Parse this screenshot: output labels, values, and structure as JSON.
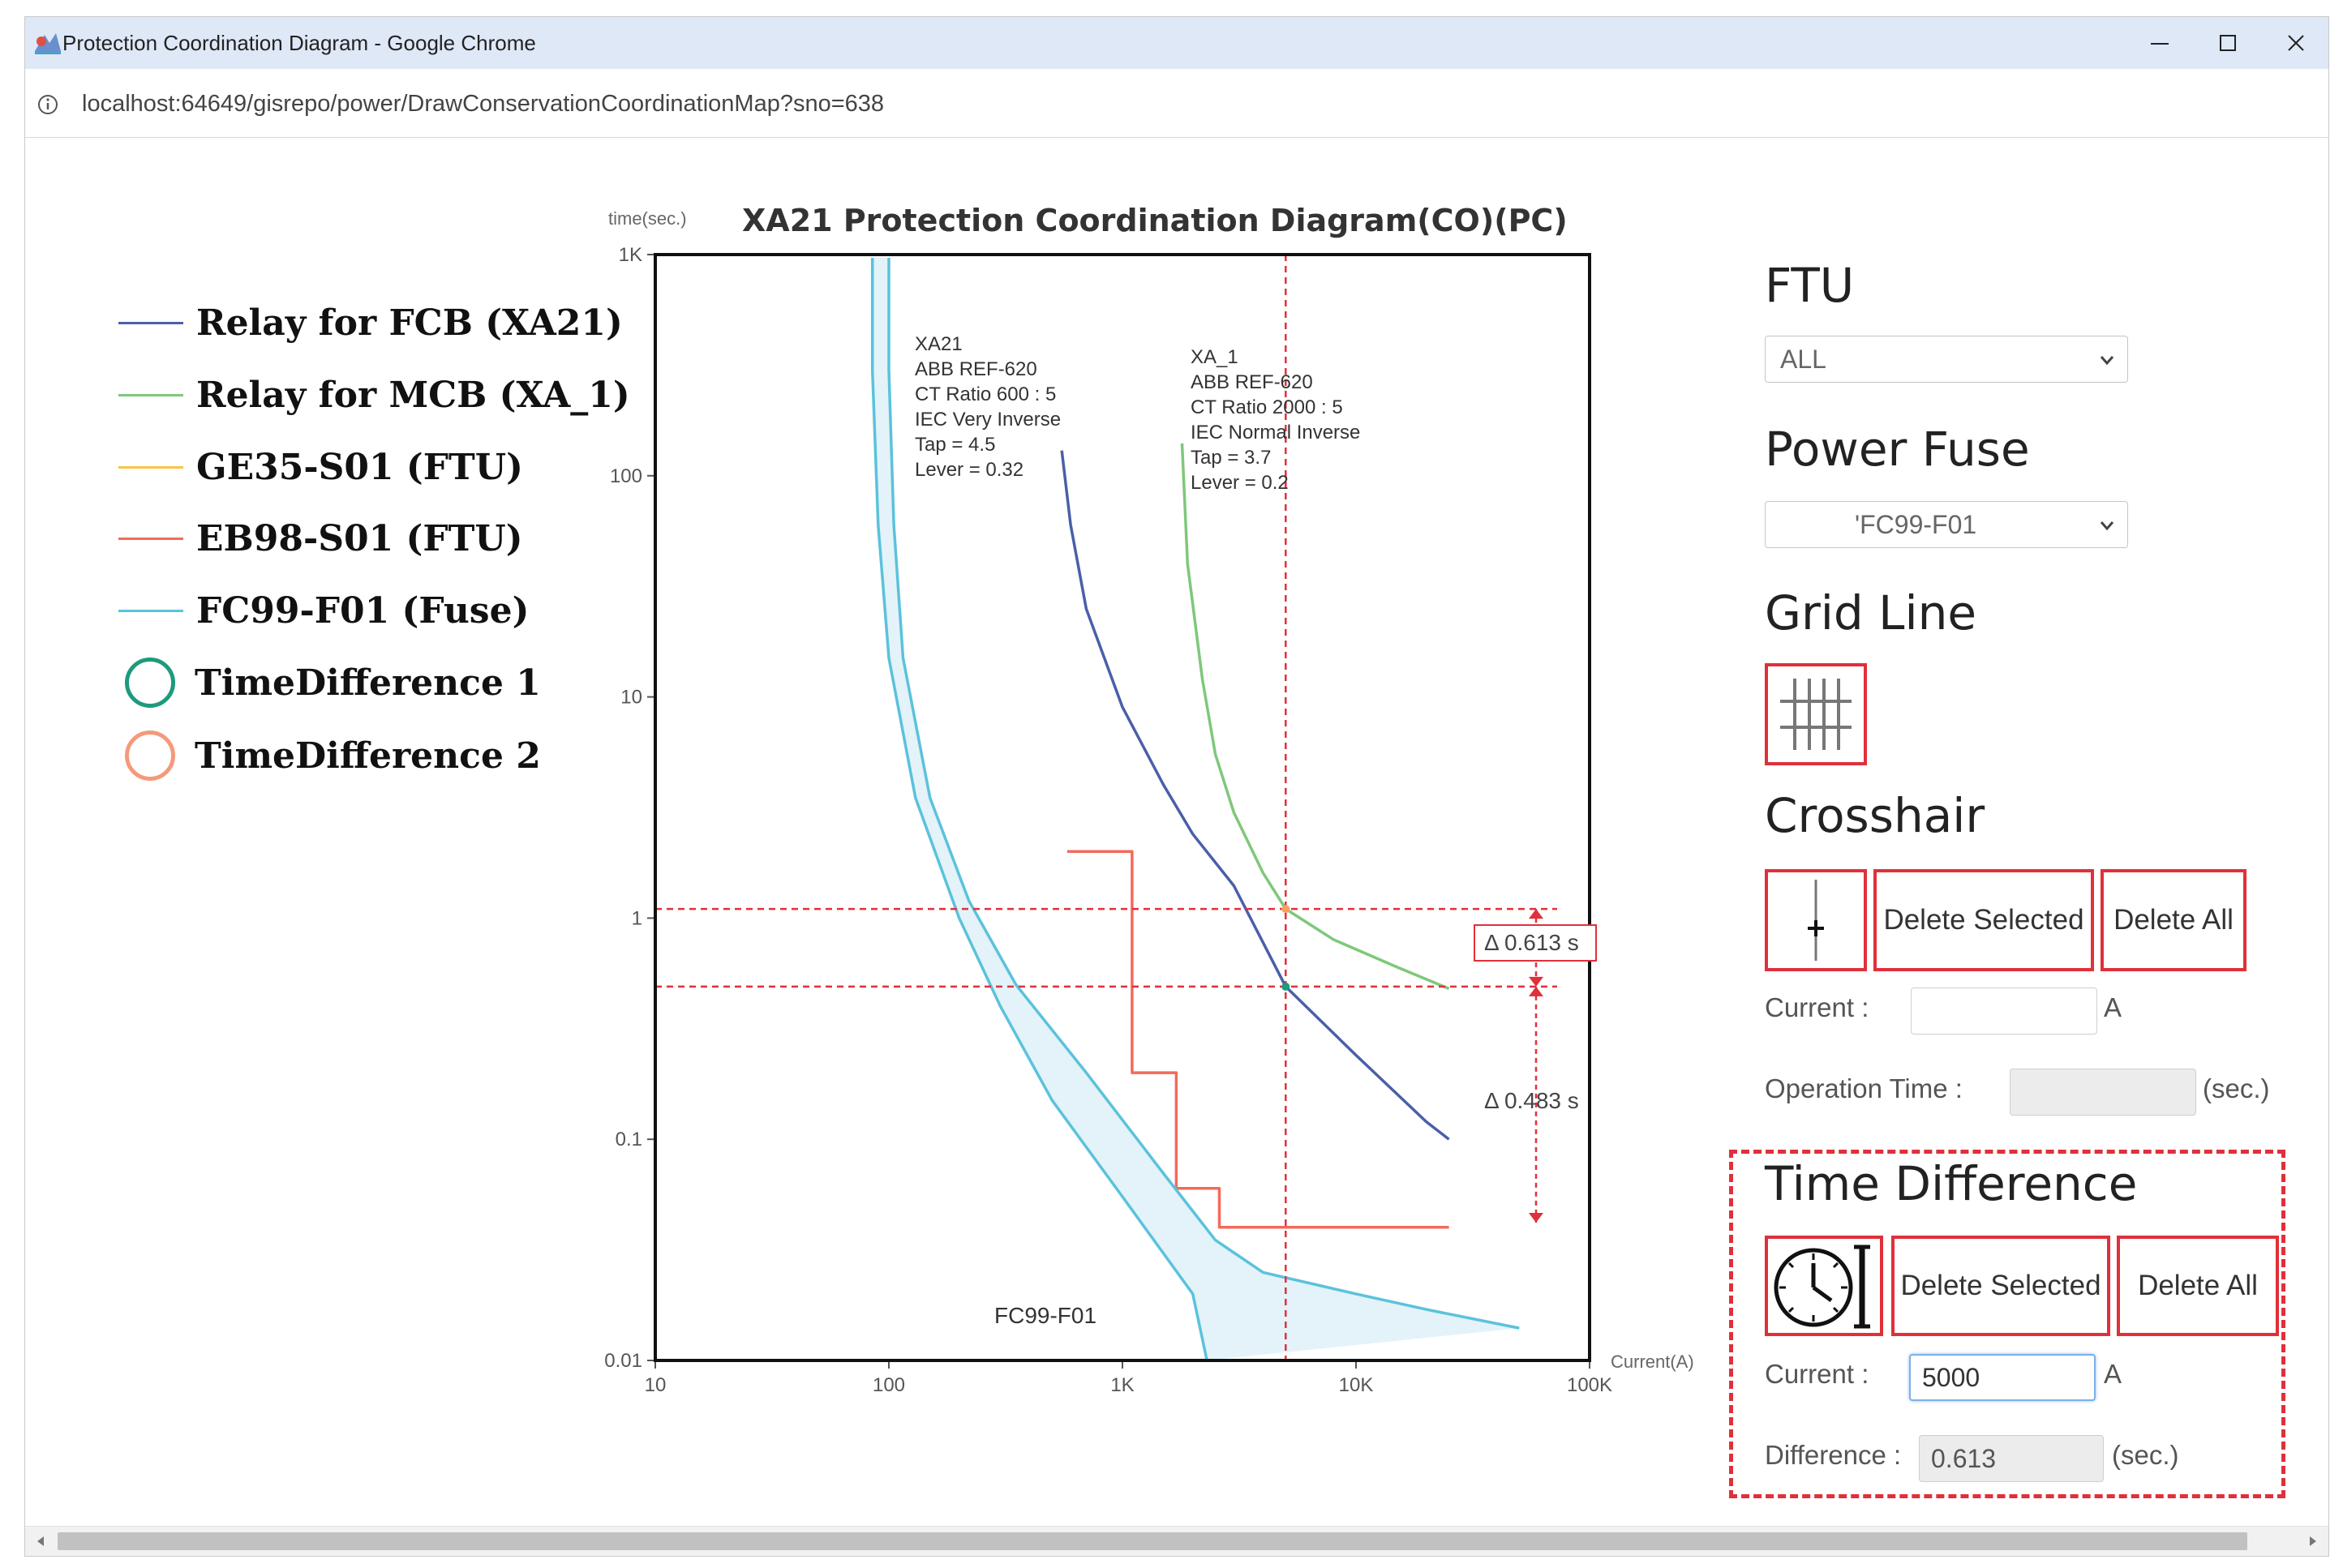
{
  "window": {
    "title": "Protection Coordination Diagram - Google Chrome",
    "url": "localhost:64649/gisrepo/power/DrawConservationCoordinationMap?sno=638",
    "controls": {
      "minimize": "—",
      "maximize": "☐",
      "close": "✕"
    }
  },
  "legend": [
    {
      "label": "Relay for FCB (XA21)",
      "color": "#4a5fa8",
      "kind": "line"
    },
    {
      "label": "Relay for MCB (XA_1)",
      "color": "#7ec87a",
      "kind": "line"
    },
    {
      "label": "GE35-S01 (FTU)",
      "color": "#f5c542",
      "kind": "line"
    },
    {
      "label": "EB98-S01 (FTU)",
      "color": "#f26a5c",
      "kind": "line"
    },
    {
      "label": "FC99-F01 (Fuse)",
      "color": "#5bc2dc",
      "kind": "line"
    },
    {
      "label": "TimeDifference 1",
      "color": "#1e9a7c",
      "kind": "circle"
    },
    {
      "label": "TimeDifference 2",
      "color": "#f59a7a",
      "kind": "circle"
    }
  ],
  "chart_data": {
    "type": "line",
    "title": "XA21 Protection Coordination Diagram(CO)(PC)",
    "ylabel": "time(sec.)",
    "xlabel": "Current(A)",
    "xscale": "log",
    "yscale": "log",
    "xlim": [
      10,
      100000
    ],
    "ylim": [
      0.01,
      1000
    ],
    "x_ticks": [
      "10",
      "100",
      "1K",
      "10K",
      "100K"
    ],
    "y_ticks": [
      "0.01",
      "0.1",
      "1",
      "10",
      "100",
      "1K"
    ],
    "crosshair": {
      "current": 5000,
      "times": [
        1.1,
        0.49
      ]
    },
    "series": [
      {
        "name": "XA21",
        "color": "#4a5fa8",
        "points": [
          [
            550,
            130
          ],
          [
            600,
            60
          ],
          [
            700,
            25
          ],
          [
            1000,
            9
          ],
          [
            1500,
            4
          ],
          [
            2000,
            2.4
          ],
          [
            3000,
            1.4
          ],
          [
            5000,
            0.49
          ],
          [
            10000,
            0.24
          ],
          [
            20000,
            0.12
          ],
          [
            25000,
            0.1
          ]
        ]
      },
      {
        "name": "XA_1",
        "color": "#7ec87a",
        "points": [
          [
            1800,
            140
          ],
          [
            1900,
            40
          ],
          [
            2200,
            12
          ],
          [
            2500,
            5.5
          ],
          [
            3000,
            3
          ],
          [
            4000,
            1.6
          ],
          [
            5000,
            1.1
          ],
          [
            8000,
            0.8
          ],
          [
            15000,
            0.6
          ],
          [
            25000,
            0.48
          ]
        ]
      },
      {
        "name": "EB98-S01",
        "color": "#f26a5c",
        "kind": "step",
        "points": [
          [
            580,
            2
          ],
          [
            1100,
            2
          ],
          [
            1100,
            0.2
          ],
          [
            1700,
            0.2
          ],
          [
            1700,
            0.06
          ],
          [
            2600,
            0.06
          ],
          [
            2600,
            0.04
          ],
          [
            25000,
            0.04
          ]
        ]
      },
      {
        "name": "FC99-F01 min",
        "color": "#5bc2dc",
        "points": [
          [
            85,
            1000
          ],
          [
            85,
            300
          ],
          [
            90,
            60
          ],
          [
            100,
            15
          ],
          [
            130,
            3.5
          ],
          [
            200,
            1
          ],
          [
            300,
            0.4
          ],
          [
            500,
            0.15
          ],
          [
            1000,
            0.055
          ],
          [
            2000,
            0.02
          ],
          [
            2300,
            0.01
          ]
        ]
      },
      {
        "name": "FC99-F01 max",
        "color": "#5bc2dc",
        "points": [
          [
            100,
            1000
          ],
          [
            100,
            300
          ],
          [
            105,
            60
          ],
          [
            115,
            15
          ],
          [
            150,
            3.5
          ],
          [
            220,
            1.2
          ],
          [
            350,
            0.5
          ],
          [
            700,
            0.2
          ],
          [
            1500,
            0.07
          ],
          [
            2500,
            0.035
          ],
          [
            4000,
            0.025
          ],
          [
            10000,
            0.02
          ],
          [
            20000,
            0.017
          ],
          [
            50000,
            0.014
          ]
        ]
      }
    ],
    "annotations": [
      {
        "text": "XA21",
        "lines": [
          "XA21",
          "ABB REF-620",
          "CT Ratio 600 : 5",
          "IEC Very Inverse",
          "Tap = 4.5",
          "Lever = 0.32"
        ]
      },
      {
        "text": "XA_1",
        "lines": [
          "XA_1",
          "ABB REF-620",
          "CT Ratio 2000 : 5",
          "IEC Normal Inverse",
          "Tap = 3.7",
          "Lever = 0.2"
        ]
      },
      {
        "text": "FC99-F01"
      }
    ],
    "time_differences": [
      {
        "label": "Δ 0.613 s",
        "value": 0.613
      },
      {
        "label": "Δ 0.483 s",
        "value": 0.483
      }
    ]
  },
  "panel": {
    "ftu": {
      "heading": "FTU",
      "selected": "ALL"
    },
    "power_fuse": {
      "heading": "Power Fuse",
      "selected": "'FC99-F01"
    },
    "grid_line": {
      "heading": "Grid Line"
    },
    "crosshair": {
      "heading": "Crosshair",
      "delete_selected": "Delete Selected",
      "delete_all": "Delete All",
      "current_label": "Current :",
      "current_value": "",
      "current_unit": "A",
      "op_time_label": "Operation Time :",
      "op_time_value": "",
      "op_time_unit": "(sec.)"
    },
    "time_difference": {
      "heading": "Time Difference",
      "delete_selected": "Delete Selected",
      "delete_all": "Delete All",
      "current_label": "Current :",
      "current_value": "5000",
      "current_unit": "A",
      "difference_label": "Difference :",
      "difference_value": "0.613",
      "difference_unit": "(sec.)"
    }
  }
}
